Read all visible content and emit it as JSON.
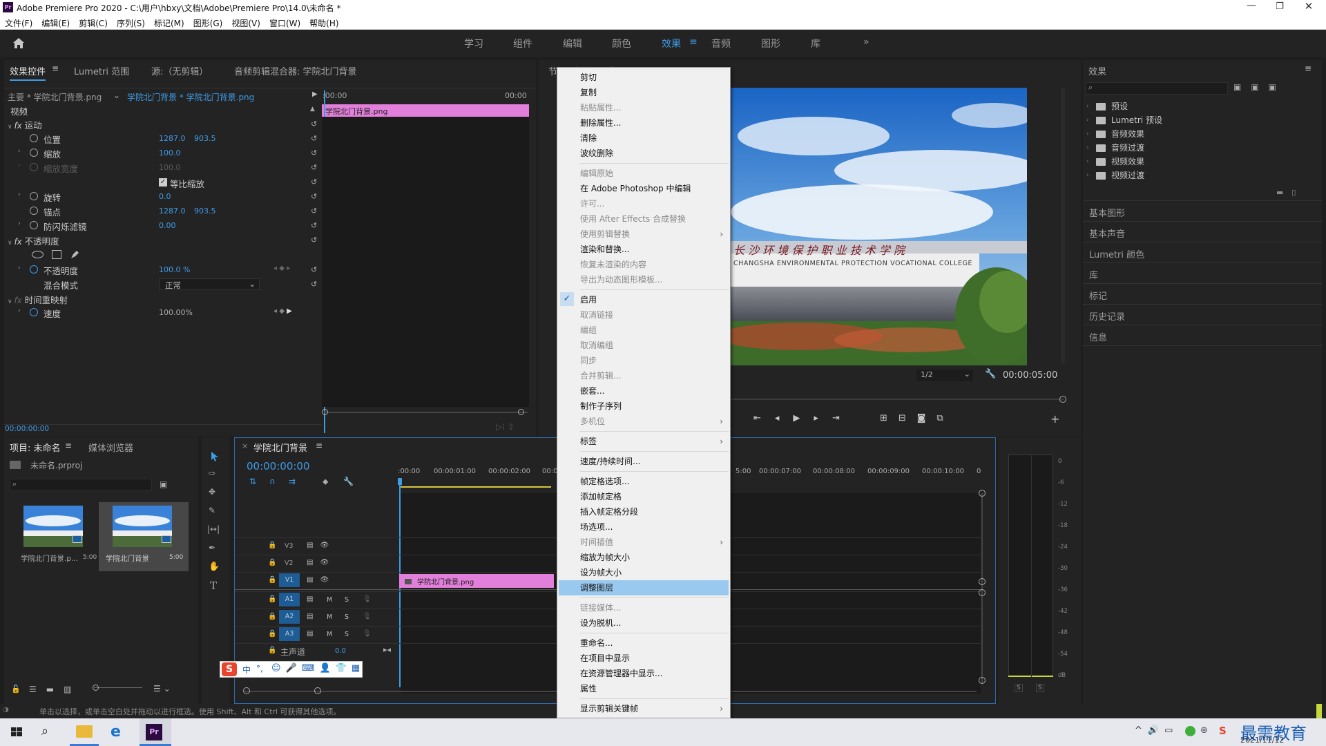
{
  "window": {
    "title": "Adobe Premiere Pro 2020 - C:\\用户\\hbxy\\文档\\Adobe\\Premiere Pro\\14.0\\未命名 *"
  },
  "menu": [
    "文件(F)",
    "编辑(E)",
    "剪辑(C)",
    "序列(S)",
    "标记(M)",
    "图形(G)",
    "视图(V)",
    "窗口(W)",
    "帮助(H)"
  ],
  "workspaces": [
    "学习",
    "组件",
    "编辑",
    "颜色",
    "效果",
    "音频",
    "图形",
    "库"
  ],
  "workspace_more": "»",
  "effect_controls": {
    "tabs": [
      "效果控件",
      "Lumetri 范围",
      "源:（无剪辑）",
      "音频剪辑混合器: 学院北门背景"
    ],
    "master": "主要 * 学院北门背景.png",
    "clip": "学院北门背景 * 学院北门背景.png",
    "time_start": ":00:00",
    "time_end": "00:00",
    "clip_bar": "学院北门背景.png",
    "section_video": "视频",
    "motion": "运动",
    "position": {
      "label": "位置",
      "x": "1287.0",
      "y": "903.5"
    },
    "scale": {
      "label": "缩放",
      "value": "100.0"
    },
    "scale_width": {
      "label": "缩放宽度",
      "value": "100.0"
    },
    "uniform_scale": "等比缩放",
    "rotation": {
      "label": "旋转",
      "value": "0.0"
    },
    "anchor": {
      "label": "锚点",
      "x": "1287.0",
      "y": "903.5"
    },
    "anti_flicker": {
      "label": "防闪烁滤镜",
      "value": "0.00"
    },
    "opacity_section": "不透明度",
    "opacity": {
      "label": "不透明度",
      "value": "100.0 %"
    },
    "blend": {
      "label": "混合模式",
      "value": "正常"
    },
    "time_remap": "时间重映射",
    "speed": {
      "label": "速度",
      "value": "100.00%"
    },
    "timecode": "00:00:00:00"
  },
  "program": {
    "title": "节目: 学院北门背景",
    "zoom": "1/2",
    "timecode": "00:00:05:00",
    "sign_cn": "长 沙 环 境 保 护 职 业 技 术 学 院",
    "sign_en": "CHANGSHA ENVIRONMENTAL PROTECTION VOCATIONAL COLLEGE"
  },
  "context_menu": {
    "items": [
      {
        "label": "剪切",
        "disabled": false
      },
      {
        "label": "复制",
        "disabled": false
      },
      {
        "label": "粘贴属性...",
        "disabled": true
      },
      {
        "label": "删除属性...",
        "disabled": false
      },
      {
        "label": "清除",
        "disabled": false
      },
      {
        "label": "波纹删除",
        "disabled": false
      },
      {
        "label": "编辑原始",
        "disabled": true
      },
      {
        "label": "在 Adobe Photoshop 中编辑",
        "disabled": false
      },
      {
        "label": "许可...",
        "disabled": true
      },
      {
        "label": "使用 After Effects 合成替换",
        "disabled": true
      },
      {
        "label": "使用剪辑替换",
        "disabled": true
      },
      {
        "label": "渲染和替换...",
        "disabled": false
      },
      {
        "label": "恢复未渲染的内容",
        "disabled": true
      },
      {
        "label": "导出为动态图形模板...",
        "disabled": true
      },
      {
        "label": "启用",
        "disabled": false
      },
      {
        "label": "取消链接",
        "disabled": true
      },
      {
        "label": "编组",
        "disabled": true
      },
      {
        "label": "取消编组",
        "disabled": true
      },
      {
        "label": "同步",
        "disabled": true
      },
      {
        "label": "合并剪辑...",
        "disabled": true
      },
      {
        "label": "嵌套...",
        "disabled": false
      },
      {
        "label": "制作子序列",
        "disabled": false
      },
      {
        "label": "多机位",
        "disabled": true
      },
      {
        "label": "标签",
        "disabled": false
      },
      {
        "label": "速度/持续时间...",
        "disabled": false
      },
      {
        "label": "帧定格选项...",
        "disabled": false
      },
      {
        "label": "添加帧定格",
        "disabled": false
      },
      {
        "label": "插入帧定格分段",
        "disabled": false
      },
      {
        "label": "场选项...",
        "disabled": false
      },
      {
        "label": "时间插值",
        "disabled": true
      },
      {
        "label": "缩放为帧大小",
        "disabled": false
      },
      {
        "label": "设为帧大小",
        "disabled": false
      },
      {
        "label": "调整图层",
        "disabled": false
      },
      {
        "label": "链接媒体...",
        "disabled": true
      },
      {
        "label": "设为脱机...",
        "disabled": false
      },
      {
        "label": "重命名...",
        "disabled": false
      },
      {
        "label": "在项目中显示",
        "disabled": false
      },
      {
        "label": "在资源管理器中显示...",
        "disabled": false
      },
      {
        "label": "属性",
        "disabled": false
      },
      {
        "label": "显示剪辑关键帧",
        "disabled": false
      }
    ]
  },
  "project": {
    "tabs": [
      "项目: 未命名",
      "媒体浏览器"
    ],
    "file": "未命名.prproj",
    "items": [
      {
        "name": "学院北门背景.p...",
        "dur": "5:00"
      },
      {
        "name": "学院北门背景",
        "dur": "5:00"
      }
    ]
  },
  "timeline": {
    "tab": "学院北门背景",
    "timecode": "00:00:00:00",
    "ruler_left": [
      ":00:00",
      "00:00:01:00",
      "00:00:02:00",
      "00:0"
    ],
    "ruler_right": [
      "5:00",
      "00:00:07:00",
      "00:00:08:00",
      "00:00:09:00",
      "00:00:10:00",
      "0"
    ],
    "video_tracks": [
      "V3",
      "V2",
      "V1"
    ],
    "audio_tracks": [
      "A1",
      "A2",
      "A3"
    ],
    "master": "主声道",
    "master_val": "0.0",
    "clip": "学院北门背景.png",
    "m": "M",
    "s": "S"
  },
  "effects_panel": {
    "title": "效果",
    "folders": [
      "预设",
      "Lumetri 预设",
      "音频效果",
      "音频过渡",
      "视频效果",
      "视频过渡"
    ],
    "panels": [
      "基本图形",
      "基本声音",
      "Lumetri 颜色",
      "库",
      "标记",
      "历史记录",
      "信息"
    ]
  },
  "audio_meter": {
    "ticks": [
      "0",
      "-6",
      "-12",
      "-18",
      "-24",
      "-30",
      "-36",
      "-42",
      "-48",
      "-54",
      "dB"
    ],
    "s": "S"
  },
  "ime": {
    "items": [
      "中",
      "°,"
    ]
  },
  "status": "单击以选择，或单击空白处并拖动以进行框选。使用 Shift、Alt 和 Ctrl 可获得其他选项。",
  "taskbar": {
    "date": "2021/11/12",
    "watermark": "最需教育"
  }
}
